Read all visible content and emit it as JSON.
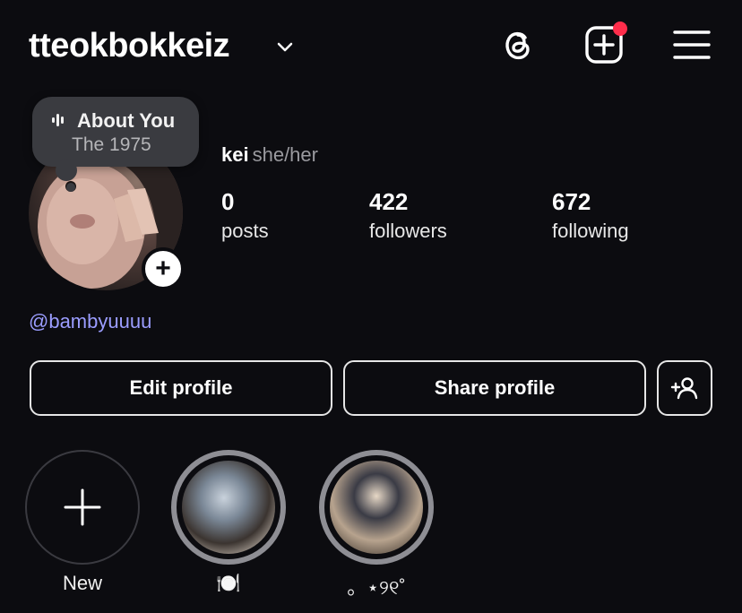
{
  "header": {
    "username": "tteokbokkeiz",
    "icons": [
      "chevron-down-icon",
      "threads-icon",
      "new-post-icon",
      "menu-icon"
    ],
    "notification_color": "#ff2d4b"
  },
  "music": {
    "title": "About You",
    "subtitle": "The 1975"
  },
  "profile": {
    "name": "kei",
    "pronouns": "she/her",
    "handle": "@bambyuuuu"
  },
  "stats": [
    {
      "value": "0",
      "label": "posts"
    },
    {
      "value": "422",
      "label": "followers"
    },
    {
      "value": "672",
      "label": "following"
    }
  ],
  "buttons": {
    "edit": "Edit profile",
    "share": "Share profile"
  },
  "highlights": [
    {
      "label": "New"
    },
    {
      "label": "🍽️"
    },
    {
      "label": "。⋆୨୧˚"
    }
  ],
  "colors": {
    "background": "#0c0c10",
    "link": "#9b9dff"
  }
}
